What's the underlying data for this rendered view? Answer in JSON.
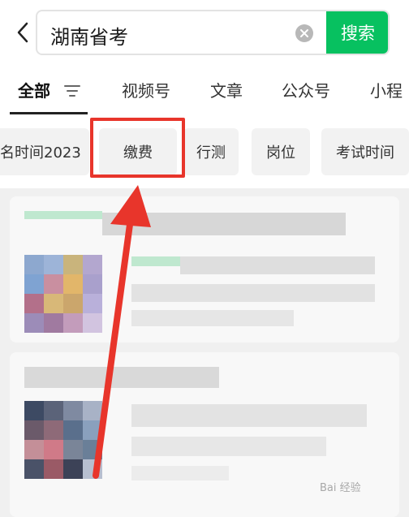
{
  "search": {
    "query": "湖南省考",
    "button_label": "搜索"
  },
  "tabs": [
    {
      "label": "全部",
      "active": true
    },
    {
      "label": "视频号"
    },
    {
      "label": "文章"
    },
    {
      "label": "公众号"
    },
    {
      "label": "小程"
    }
  ],
  "chips": [
    {
      "label": "名时间2023"
    },
    {
      "label": "缴费",
      "highlighted": true
    },
    {
      "label": "行测"
    },
    {
      "label": "岗位"
    },
    {
      "label": "考试时间"
    }
  ],
  "colors": {
    "accent": "#07c160",
    "highlight": "#e8352b"
  },
  "watermark": {
    "text": "Bai 经验"
  }
}
